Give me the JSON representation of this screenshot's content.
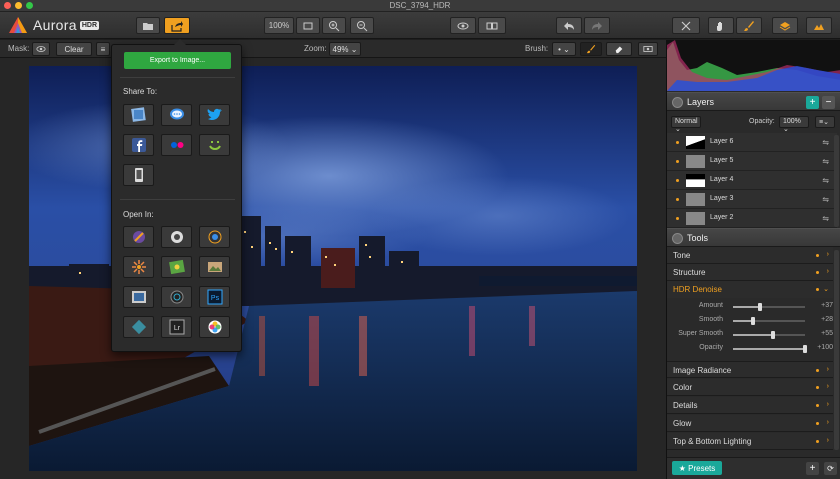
{
  "window": {
    "title": "DSC_3794_HDR"
  },
  "app": {
    "name": "Aurora",
    "badge": "HDR"
  },
  "toolbar": {
    "zoom_label": "100%",
    "items": [
      "folder-icon",
      "share-icon",
      "fit-icon",
      "zoom-in-icon",
      "zoom-out-icon",
      "eye-icon",
      "compare-icon",
      "undo-icon",
      "redo-icon",
      "crop-tools-icon",
      "hand-icon",
      "brush-icon",
      "layers-icon",
      "histogram-icon"
    ]
  },
  "optbar": {
    "mask_label": "Mask:",
    "clear_label": "Clear",
    "zoom_label": "Zoom:",
    "zoom_value": "49%",
    "brush_label": "Brush:"
  },
  "share_menu": {
    "export_label": "Export to Image...",
    "share_to_label": "Share To:",
    "open_in_label": "Open In:",
    "share_items": [
      "photos-icon",
      "messages-icon",
      "twitter-icon",
      "facebook-icon",
      "flickr-icon",
      "smugmug-icon",
      "500px-icon"
    ],
    "open_items": [
      "app-1-icon",
      "app-2-icon",
      "app-3-icon",
      "app-4-icon",
      "app-5-icon",
      "app-6-icon",
      "app-7-icon",
      "app-8-icon",
      "photoshop-icon",
      "app-9-icon",
      "lightroom-icon",
      "photos-app-icon"
    ],
    "photoshop_text": "Ps",
    "lightroom_text": "Lr"
  },
  "layers": {
    "title": "Layers",
    "blend_mode": "Normal",
    "opacity_label": "Opacity:",
    "opacity_value": "100%",
    "items": [
      {
        "name": "Layer 6"
      },
      {
        "name": "Layer 5"
      },
      {
        "name": "Layer 4"
      },
      {
        "name": "Layer 3"
      },
      {
        "name": "Layer 2"
      }
    ]
  },
  "tools": {
    "title": "Tools",
    "sections": [
      "Tone",
      "Structure",
      "HDR Denoise"
    ],
    "hdr_denoise": {
      "sliders": [
        {
          "label": "Amount",
          "value": "+37",
          "level": 0.37
        },
        {
          "label": "Smooth",
          "value": "+28",
          "level": 0.28
        },
        {
          "label": "Super Smooth",
          "value": "+55",
          "level": 0.55
        },
        {
          "label": "Opacity",
          "value": "+100",
          "level": 1.0
        }
      ]
    },
    "more_sections": [
      "Image Radiance",
      "Color",
      "Details",
      "Glow",
      "Top & Bottom Lighting"
    ]
  },
  "bottom": {
    "presets_label": "Presets"
  },
  "colors": {
    "accent": "#f0a020",
    "export": "#2fa740",
    "presets": "#1aa89a"
  }
}
